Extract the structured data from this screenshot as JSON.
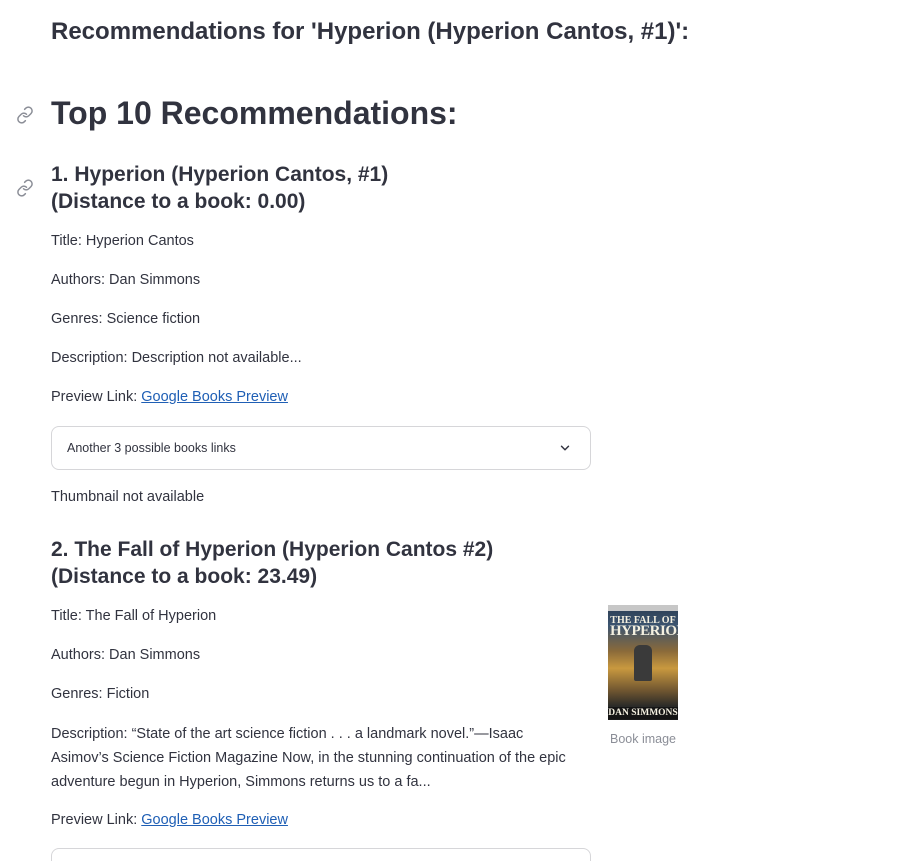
{
  "header": {
    "title": "Recommendations for 'Hyperion (Hyperion Cantos, #1)':"
  },
  "section": {
    "title": "Top 10 Recommendations:"
  },
  "recommendations": [
    {
      "heading_line1": "1. Hyperion (Hyperion Cantos, #1)",
      "heading_line2": "(Distance to a book: 0.00)",
      "title": "Title: Hyperion Cantos",
      "authors": "Authors: Dan Simmons",
      "genres": "Genres: Science fiction",
      "description": "Description: Description not available...",
      "preview_label": "Preview Link: ",
      "preview_link_text": "Google Books Preview",
      "expander_label": "Another 3 possible books links",
      "thumbnail_text": "Thumbnail not available"
    },
    {
      "heading_line1": "2. The Fall of Hyperion (Hyperion Cantos #2)",
      "heading_line2": "(Distance to a book: 23.49)",
      "title": "Title: The Fall of Hyperion",
      "authors": "Authors: Dan Simmons",
      "genres": "Genres: Fiction",
      "description": "Description: “State of the art science fiction . . . a landmark novel.”—Isaac Asimov’s Science Fiction Magazine Now, in the stunning continuation of the epic adventure begun in Hyperion, Simmons returns us to a fa...",
      "preview_label": "Preview Link: ",
      "preview_link_text": "Google Books Preview",
      "image_caption": "Book image",
      "cover": {
        "title_small": "THE FALL OF",
        "title_large": "HYPERION",
        "author": "DAN SIMMONS"
      }
    }
  ],
  "icons": {
    "anchor": "link-icon",
    "chevron": "chevron-down-icon"
  },
  "colors": {
    "text": "#31333f",
    "link": "#1f5fb5",
    "caption": "#8b8e97",
    "border": "#d6d6d9"
  }
}
